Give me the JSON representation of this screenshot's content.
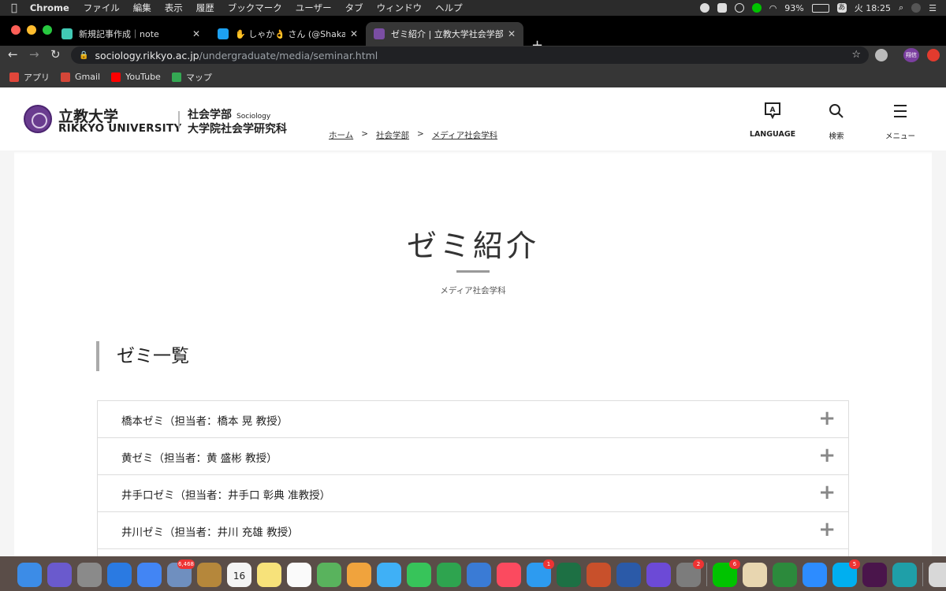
{
  "menubar": {
    "app": "Chrome",
    "items": [
      "ファイル",
      "編集",
      "表示",
      "履歴",
      "ブックマーク",
      "ユーザー",
      "タブ",
      "ウィンドウ",
      "ヘルプ"
    ],
    "battery": "93%",
    "ime": "あ",
    "clock": "火 18:25"
  },
  "tabs": [
    {
      "title": "新規記事作成｜note",
      "fav_color": "#41c9b4"
    },
    {
      "title": "✋ しゃか👌 さん (@Shaka__kt_",
      "fav_color": "#1da1f2"
    },
    {
      "title": "ゼミ紹介 | 立教大学社会学部 / ナ",
      "fav_color": "#7a4ea3"
    }
  ],
  "toolbar": {
    "url_host": "sociology.rikkyo.ac.jp",
    "url_path": "/undergraduate/media/seminar.html",
    "profile_label": "翔信"
  },
  "bookmarks": [
    {
      "label": "アプリ",
      "color": "#e0463a"
    },
    {
      "label": "Gmail",
      "color": "#d44638"
    },
    {
      "label": "YouTube",
      "color": "#ff0000"
    },
    {
      "label": "マップ",
      "color": "#34a853"
    }
  ],
  "site": {
    "logo_ja": "立教大学",
    "logo_en": "RIKKYO UNIVERSITY",
    "dept_line1": "社会学部",
    "dept_en": "Sociology",
    "dept_line2": "大学院社会学研究科",
    "breadcrumb": [
      {
        "label": "ホーム"
      },
      {
        "sep": ">",
        "label": "社会学部"
      },
      {
        "sep": ">",
        "label": "メディア社会学科"
      }
    ],
    "language_label": "LANGUAGE",
    "search_label": "検索",
    "menu_label": "メニュー"
  },
  "main": {
    "title": "ゼミ紹介",
    "subtitle": "メディア社会学科",
    "section_title": "ゼミ一覧",
    "seminars": [
      "橋本ゼミ（担当者：橋本 晃 教授）",
      "黄ゼミ（担当者：黄 盛彬 教授）",
      "井手口ゼミ（担当者：井手口 彰典 准教授）",
      "井川ゼミ（担当者：井川 充雄 教授）"
    ]
  },
  "dock": {
    "apps": [
      {
        "name": "finder",
        "color": "#3c8ce7"
      },
      {
        "name": "siri",
        "color": "#6a5acd"
      },
      {
        "name": "launchpad",
        "color": "#8a8a8a"
      },
      {
        "name": "safari",
        "color": "#2a7ae2"
      },
      {
        "name": "chrome",
        "color": "#4285f4"
      },
      {
        "name": "preview",
        "color": "#6f8fbf",
        "badge": "6,468"
      },
      {
        "name": "notefile",
        "color": "#b5873b"
      },
      {
        "name": "calendar",
        "color": "#f4f4f4",
        "label": "16"
      },
      {
        "name": "notes",
        "color": "#f7e27a"
      },
      {
        "name": "reminders",
        "color": "#fafafa"
      },
      {
        "name": "maps",
        "color": "#59b35d"
      },
      {
        "name": "photos",
        "color": "#f0a33d"
      },
      {
        "name": "messages",
        "color": "#3fb0f6"
      },
      {
        "name": "facetime",
        "color": "#37c45a"
      },
      {
        "name": "numbers",
        "color": "#2ea44f"
      },
      {
        "name": "keynote",
        "color": "#3a7bd5"
      },
      {
        "name": "music",
        "color": "#fb4a5f"
      },
      {
        "name": "app-store",
        "color": "#2d9bf0",
        "badge": "1"
      },
      {
        "name": "excel",
        "color": "#1d7044"
      },
      {
        "name": "powerpoint",
        "color": "#c8502b"
      },
      {
        "name": "word",
        "color": "#2b5aa8"
      },
      {
        "name": "imovie",
        "color": "#6c4ad6"
      },
      {
        "name": "system-preferences",
        "color": "#7c7c7c",
        "badge": "2"
      },
      {
        "name": "line",
        "color": "#00c300",
        "badge": "6"
      },
      {
        "name": "textedit",
        "color": "#e8d6b0"
      },
      {
        "name": "circle-app",
        "color": "#2c8a3c"
      },
      {
        "name": "zoom",
        "color": "#2d8cff"
      },
      {
        "name": "skype",
        "color": "#00aff0",
        "badge": "5"
      },
      {
        "name": "slack",
        "color": "#4a154b"
      },
      {
        "name": "edge",
        "color": "#1f9fa8"
      },
      {
        "name": "keyboard-viewer",
        "color": "#d8d8d8"
      },
      {
        "name": "trash",
        "color": "#c9c9c9"
      }
    ]
  }
}
